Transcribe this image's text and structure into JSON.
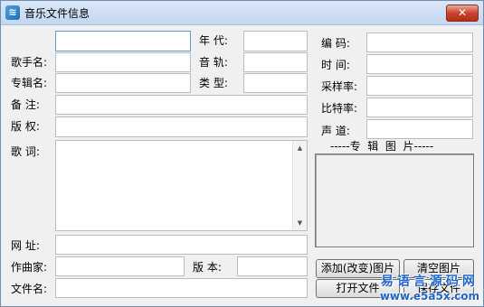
{
  "window": {
    "title": "音乐文件信息",
    "close_glyph": "✕",
    "app_icon": "e5-logo-icon",
    "app_icon_glyph": "≋"
  },
  "labels": {
    "year": "年  代:",
    "singer": "歌手名:",
    "track": "音  轨:",
    "album": "专辑名:",
    "type": "类  型:",
    "comment": "备  注:",
    "copyright": "版  权:",
    "lyrics": "歌  词:",
    "url": "网  址:",
    "composer": "作曲家:",
    "version": "版  本:",
    "filename": "文件名:",
    "encoding": "编  码:",
    "time": "时  间:",
    "sample_rate": "采样率:",
    "bit_rate": "比特率:",
    "channels": "声  道:",
    "album_picture": "-----专  辑  图  片-----"
  },
  "fields": {
    "title": "",
    "year": "",
    "singer": "",
    "track": "",
    "album": "",
    "type": "",
    "comment": "",
    "copyright": "",
    "lyrics": "",
    "url": "",
    "composer": "",
    "version": "",
    "filename": "",
    "encoding": "",
    "time": "",
    "sample_rate": "",
    "bit_rate": "",
    "channels": ""
  },
  "buttons": {
    "add_change_picture": "添加(改变)图片",
    "clear_picture": "清空图片",
    "open_file": "打开文件",
    "save_file": "保存文件"
  },
  "watermark": {
    "site_name": "易语言源码网",
    "url": "www.e5a5x.com"
  }
}
